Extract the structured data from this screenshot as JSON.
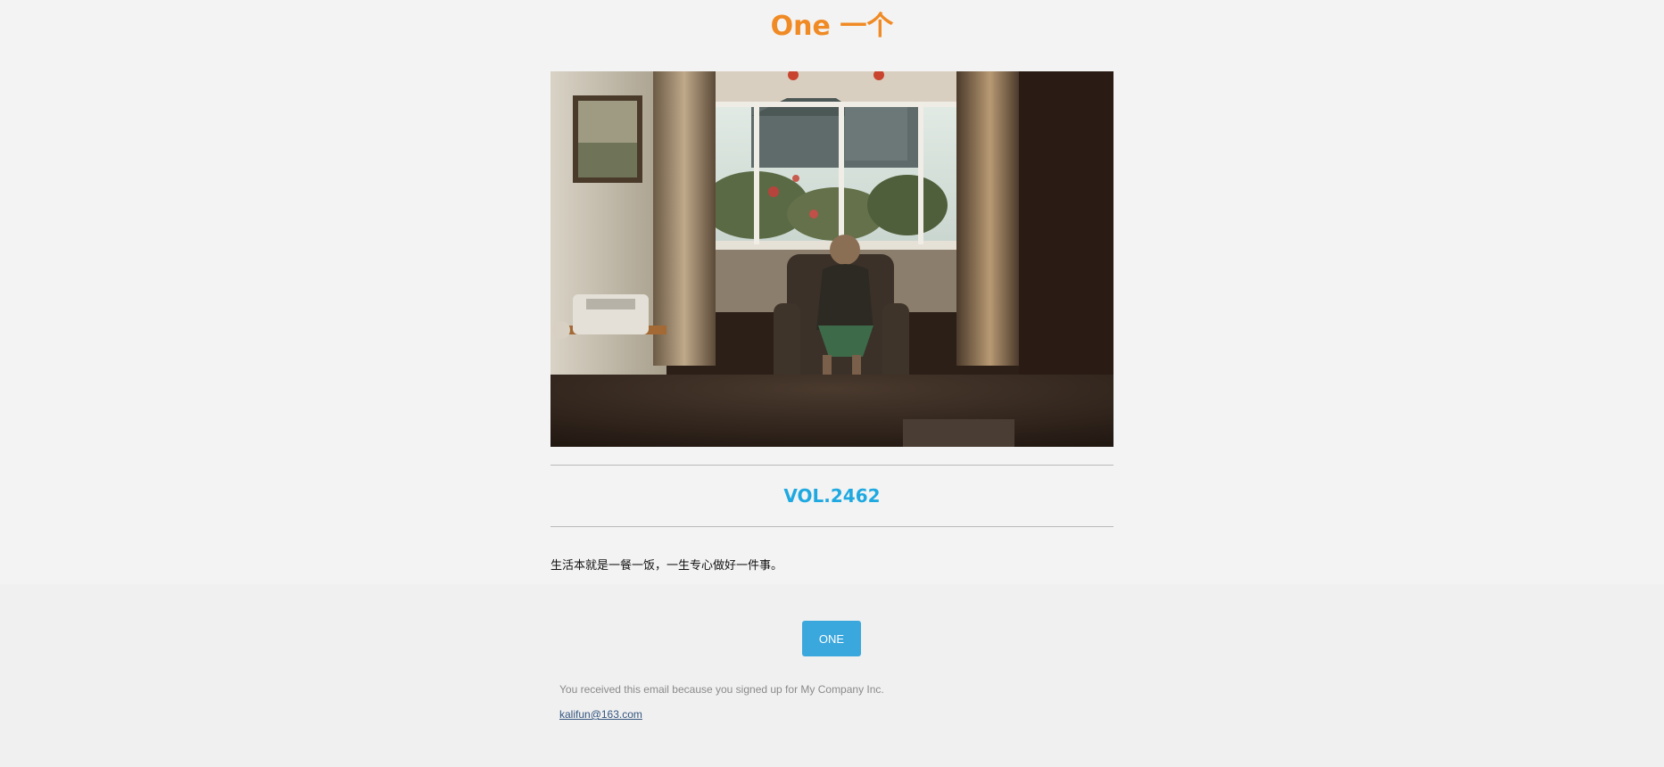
{
  "header": {
    "brand": "One 一个"
  },
  "hero": {
    "image": "photo-elderly-woman-armchair-by-bay-window"
  },
  "issue": {
    "volume": "VOL.2462",
    "quote": "生活本就是一餐一饭，一生专心做好一件事。"
  },
  "actions": {
    "primary_label": "ONE"
  },
  "footer": {
    "notice": "You received this email because you signed up for My Company Inc.",
    "email": "kalifun@163.com"
  },
  "colors": {
    "brand": "#f08a24",
    "volume": "#1fa9e1",
    "button": "#3aa7dd",
    "link": "#33557f"
  }
}
